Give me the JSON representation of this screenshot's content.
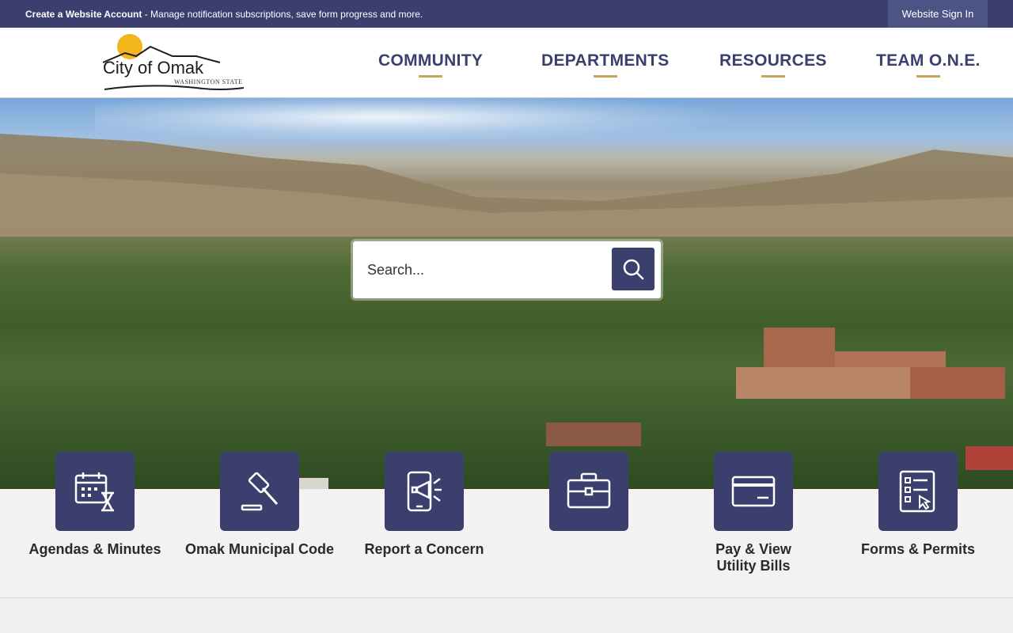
{
  "topbar": {
    "create_account": "Create a Website Account",
    "message": " - Manage notification subscriptions, save form progress and more.",
    "sign_in": "Website Sign In"
  },
  "logo": {
    "name": "City of Omak",
    "state": "WASHINGTON STATE"
  },
  "nav": {
    "items": [
      {
        "label": "COMMUNITY"
      },
      {
        "label": "DEPARTMENTS"
      },
      {
        "label": "RESOURCES"
      },
      {
        "label": "TEAM O.N.E."
      }
    ]
  },
  "search": {
    "placeholder": "Search..."
  },
  "quick_links": [
    {
      "label": "Agendas & Minutes",
      "icon": "calendar-hourglass-icon"
    },
    {
      "label": "Omak Municipal Code",
      "icon": "gavel-icon"
    },
    {
      "label": "Report a Concern",
      "icon": "phone-megaphone-icon"
    },
    {
      "label": "",
      "icon": "briefcase-icon"
    },
    {
      "label": "Pay & View Utility Bills",
      "icon": "credit-card-icon"
    },
    {
      "label": "Forms & Permits",
      "icon": "checklist-form-icon"
    }
  ],
  "colors": {
    "brand_navy": "#3b3f6e",
    "accent_gold": "#c9a35a",
    "sun_yellow": "#f3b51c"
  }
}
